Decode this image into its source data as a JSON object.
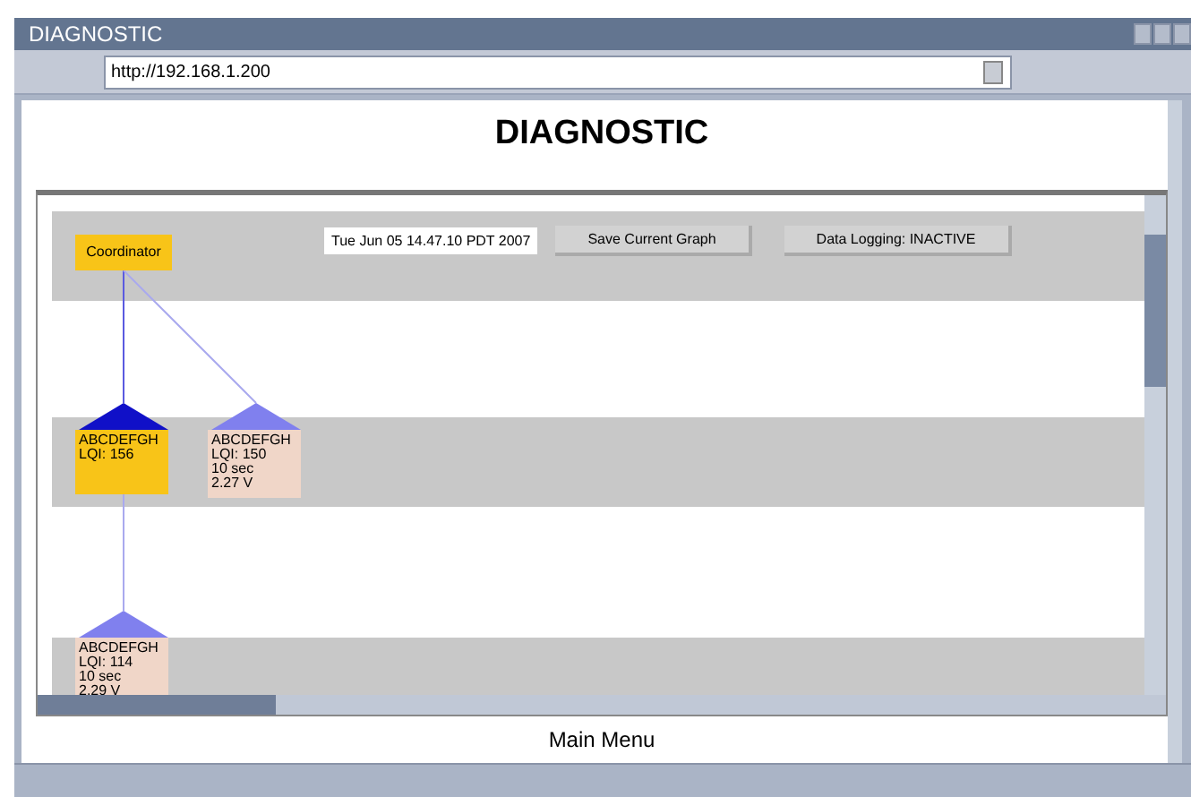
{
  "window": {
    "title": "DIAGNOSTIC"
  },
  "address_bar": {
    "value": "http://192.168.1.200"
  },
  "page_title": "DIAGNOSTIC",
  "toolbar": {
    "timestamp": "Tue Jun 05 14.47.10 PDT 2007",
    "buttons": [
      "Save Current Graph",
      "Data Logging: INACTIVE"
    ]
  },
  "tree": {
    "label": "Coordinator",
    "children": [
      {
        "lines": [
          "ABCDEFGH",
          "LQI: 156"
        ],
        "selected": true,
        "children": [
          {
            "lines": [
              "ABCDEFGH",
              "LQI: 114",
              "10 sec",
              "2.29 V"
            ],
            "selected": false
          }
        ]
      },
      {
        "lines": [
          "ABCDEFGH",
          "LQI: 150",
          "10 sec",
          "2.27 V"
        ],
        "selected": false
      }
    ]
  },
  "footer_link": "Main Menu"
}
